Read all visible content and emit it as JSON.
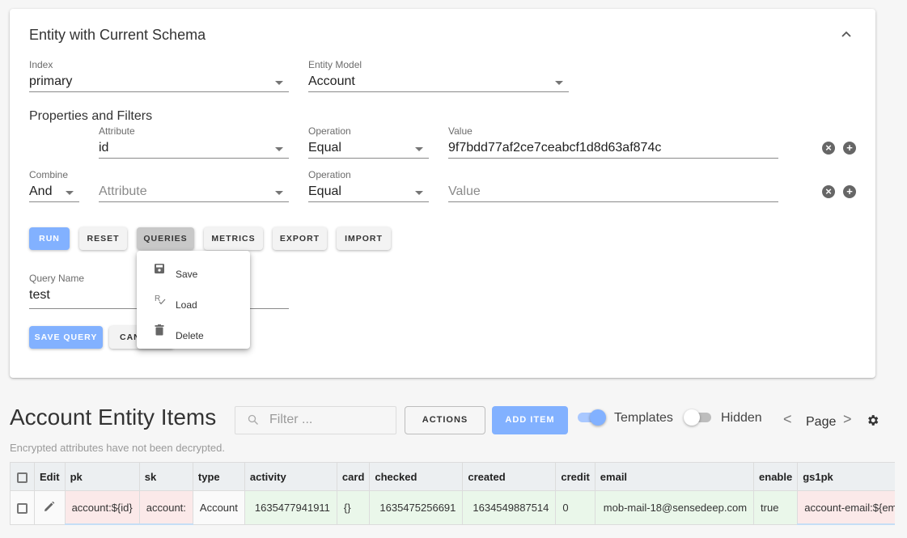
{
  "panel": {
    "title": "Entity with Current Schema",
    "index": {
      "label": "Index",
      "value": "primary"
    },
    "entity_model": {
      "label": "Entity Model",
      "value": "Account"
    },
    "properties_title": "Properties and Filters",
    "filters": [
      {
        "combine_label": "",
        "combine_value": "",
        "attribute_label": "Attribute",
        "attribute_value": "id",
        "operation_label": "Operation",
        "operation_value": "Equal",
        "value_label": "Value",
        "value_value": "9f7bdd77af2ce7ceabcf1d8d63af874c"
      },
      {
        "combine_label": "Combine",
        "combine_value": "And",
        "attribute_label": "",
        "attribute_placeholder": "Attribute",
        "operation_label": "Operation",
        "operation_value": "Equal",
        "value_label": "",
        "value_placeholder": "Value"
      }
    ],
    "buttons": {
      "run": "RUN",
      "reset": "RESET",
      "queries": "QUERIES",
      "metrics": "METRICS",
      "export": "EXPORT",
      "import": "IMPORT"
    },
    "query_name": {
      "label": "Query Name",
      "value": "test"
    },
    "save_query": "SAVE QUERY",
    "cancel": "CANCEL",
    "queries_menu": [
      {
        "icon": "save-icon",
        "label": "Save"
      },
      {
        "icon": "load-icon",
        "label": "Load"
      },
      {
        "icon": "delete-icon",
        "label": "Delete"
      }
    ]
  },
  "items": {
    "title": "Account Entity Items",
    "filter_placeholder": "Filter ...",
    "actions": "ACTIONS",
    "add_item": "ADD ITEM",
    "templates_label": "Templates",
    "templates_on": true,
    "hidden_label": "Hidden",
    "hidden_on": false,
    "page_label": "Page",
    "prev": "<",
    "next": ">",
    "note": "Encrypted attributes have not been decrypted."
  },
  "table": {
    "headers": [
      "",
      "Edit",
      "pk",
      "sk",
      "type",
      "activity",
      "card",
      "checked",
      "created",
      "credit",
      "email",
      "enable",
      "gs1pk"
    ],
    "rows": [
      [
        "",
        "",
        "account:${id}",
        "account:",
        "Account",
        "1635477941911",
        "{}",
        "1635475256691",
        "1634549887514",
        "0",
        "mob-mail-18@sensedeep.com",
        "true",
        "account-email:${email}"
      ]
    ]
  },
  "colors": {
    "accent": "#82b1ff",
    "key_cell": "#fbe9e9",
    "value_cell": "#eaf7ea"
  }
}
